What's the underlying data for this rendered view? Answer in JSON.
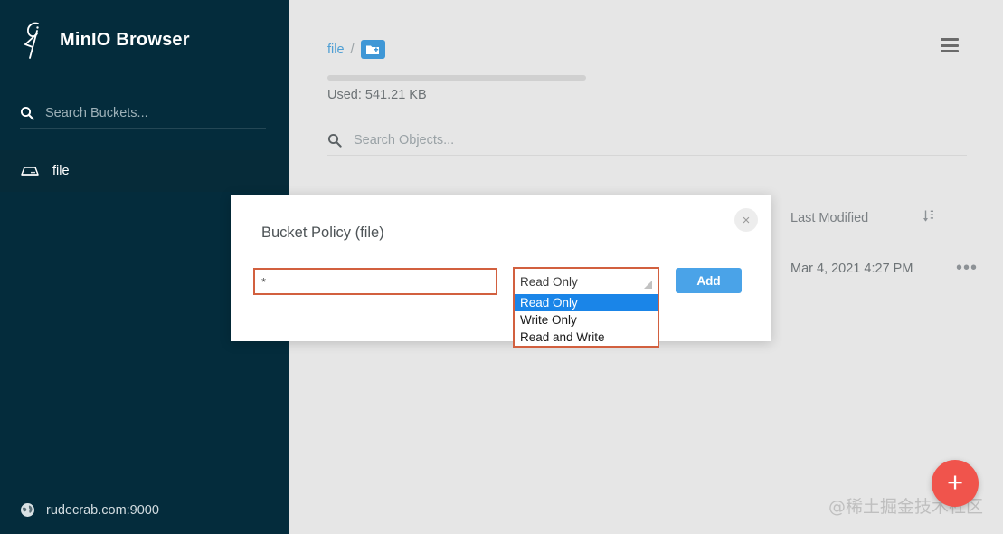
{
  "sidebar": {
    "brand_title": "MinIO Browser",
    "brand_logo_icon": "minio-stork-logo",
    "search": {
      "icon": "search-icon",
      "placeholder": "Search Buckets...",
      "value": ""
    },
    "buckets": [
      {
        "label": "file",
        "icon": "bucket-icon",
        "active": true
      }
    ],
    "status": {
      "icon": "globe-icon",
      "host": "rudecrab.com:9000"
    }
  },
  "main": {
    "menu_icon": "hamburger-menu-icon",
    "breadcrumb": {
      "bucket": "file",
      "separator": "/",
      "new_folder_icon": "new-folder-icon"
    },
    "usage": {
      "label": "Used: 541.21 KB",
      "bar_percent": 100
    },
    "object_search": {
      "icon": "search-icon",
      "placeholder": "Search Objects...",
      "value": ""
    },
    "table": {
      "columns": [
        "Last Modified"
      ],
      "sort_icon": "sort-icon",
      "rows": [
        {
          "last_modified": "Mar 4, 2021 4:27 PM",
          "menu": "•••"
        }
      ]
    },
    "fab": {
      "icon": "plus-icon",
      "label": "+"
    },
    "watermark": "@稀土掘金技术社区"
  },
  "modal": {
    "title": "Bucket Policy (file)",
    "close_label": "×",
    "prefix_input": {
      "value": "*",
      "placeholder": ""
    },
    "policy_select": {
      "selected": "Read Only",
      "options": [
        "Read Only",
        "Write Only",
        "Read and Write"
      ],
      "open": true
    },
    "add_label": "Add"
  },
  "colors": {
    "sidebar_bg": "#042c3c",
    "sidebar_active": "#062b39",
    "main_bg": "#e6e6e6",
    "accent_blue": "#4aa3e8",
    "link_blue": "#4f9fd4",
    "highlight_blue": "#1a85e8",
    "focus_orange": "#d2603f",
    "fab_red": "#f0544c"
  }
}
